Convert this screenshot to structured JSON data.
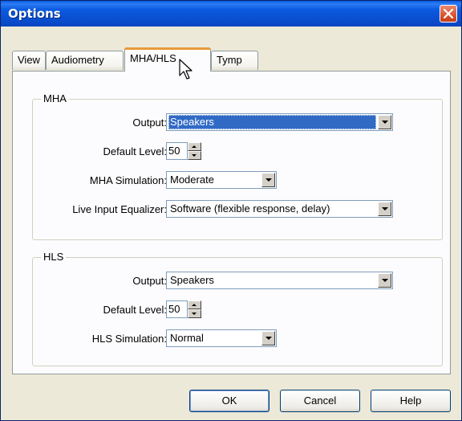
{
  "window": {
    "title": "Options"
  },
  "tabs": [
    {
      "label": "View",
      "active": false
    },
    {
      "label": "Audiometry",
      "active": false
    },
    {
      "label": "MHA/HLS",
      "active": true
    },
    {
      "label": "Tymp",
      "active": false
    }
  ],
  "mha": {
    "group_label": "MHA",
    "output": {
      "label": "Output:",
      "value": "Speakers"
    },
    "default_level": {
      "label": "Default Level:",
      "value": "50"
    },
    "simulation": {
      "label": "MHA Simulation:",
      "value": "Moderate"
    },
    "equalizer": {
      "label": "Live Input Equalizer:",
      "value": "Software (flexible response, delay)"
    }
  },
  "hls": {
    "group_label": "HLS",
    "output": {
      "label": "Output:",
      "value": "Speakers"
    },
    "default_level": {
      "label": "Default Level:",
      "value": "50"
    },
    "simulation": {
      "label": "HLS Simulation:",
      "value": "Normal"
    }
  },
  "buttons": {
    "ok": "OK",
    "cancel": "Cancel",
    "help": "Help"
  },
  "colors": {
    "titlebar": "#0a5ae0",
    "selection": "#316ac5",
    "close": "#d9552f",
    "tab_highlight": "#e79a3c"
  }
}
